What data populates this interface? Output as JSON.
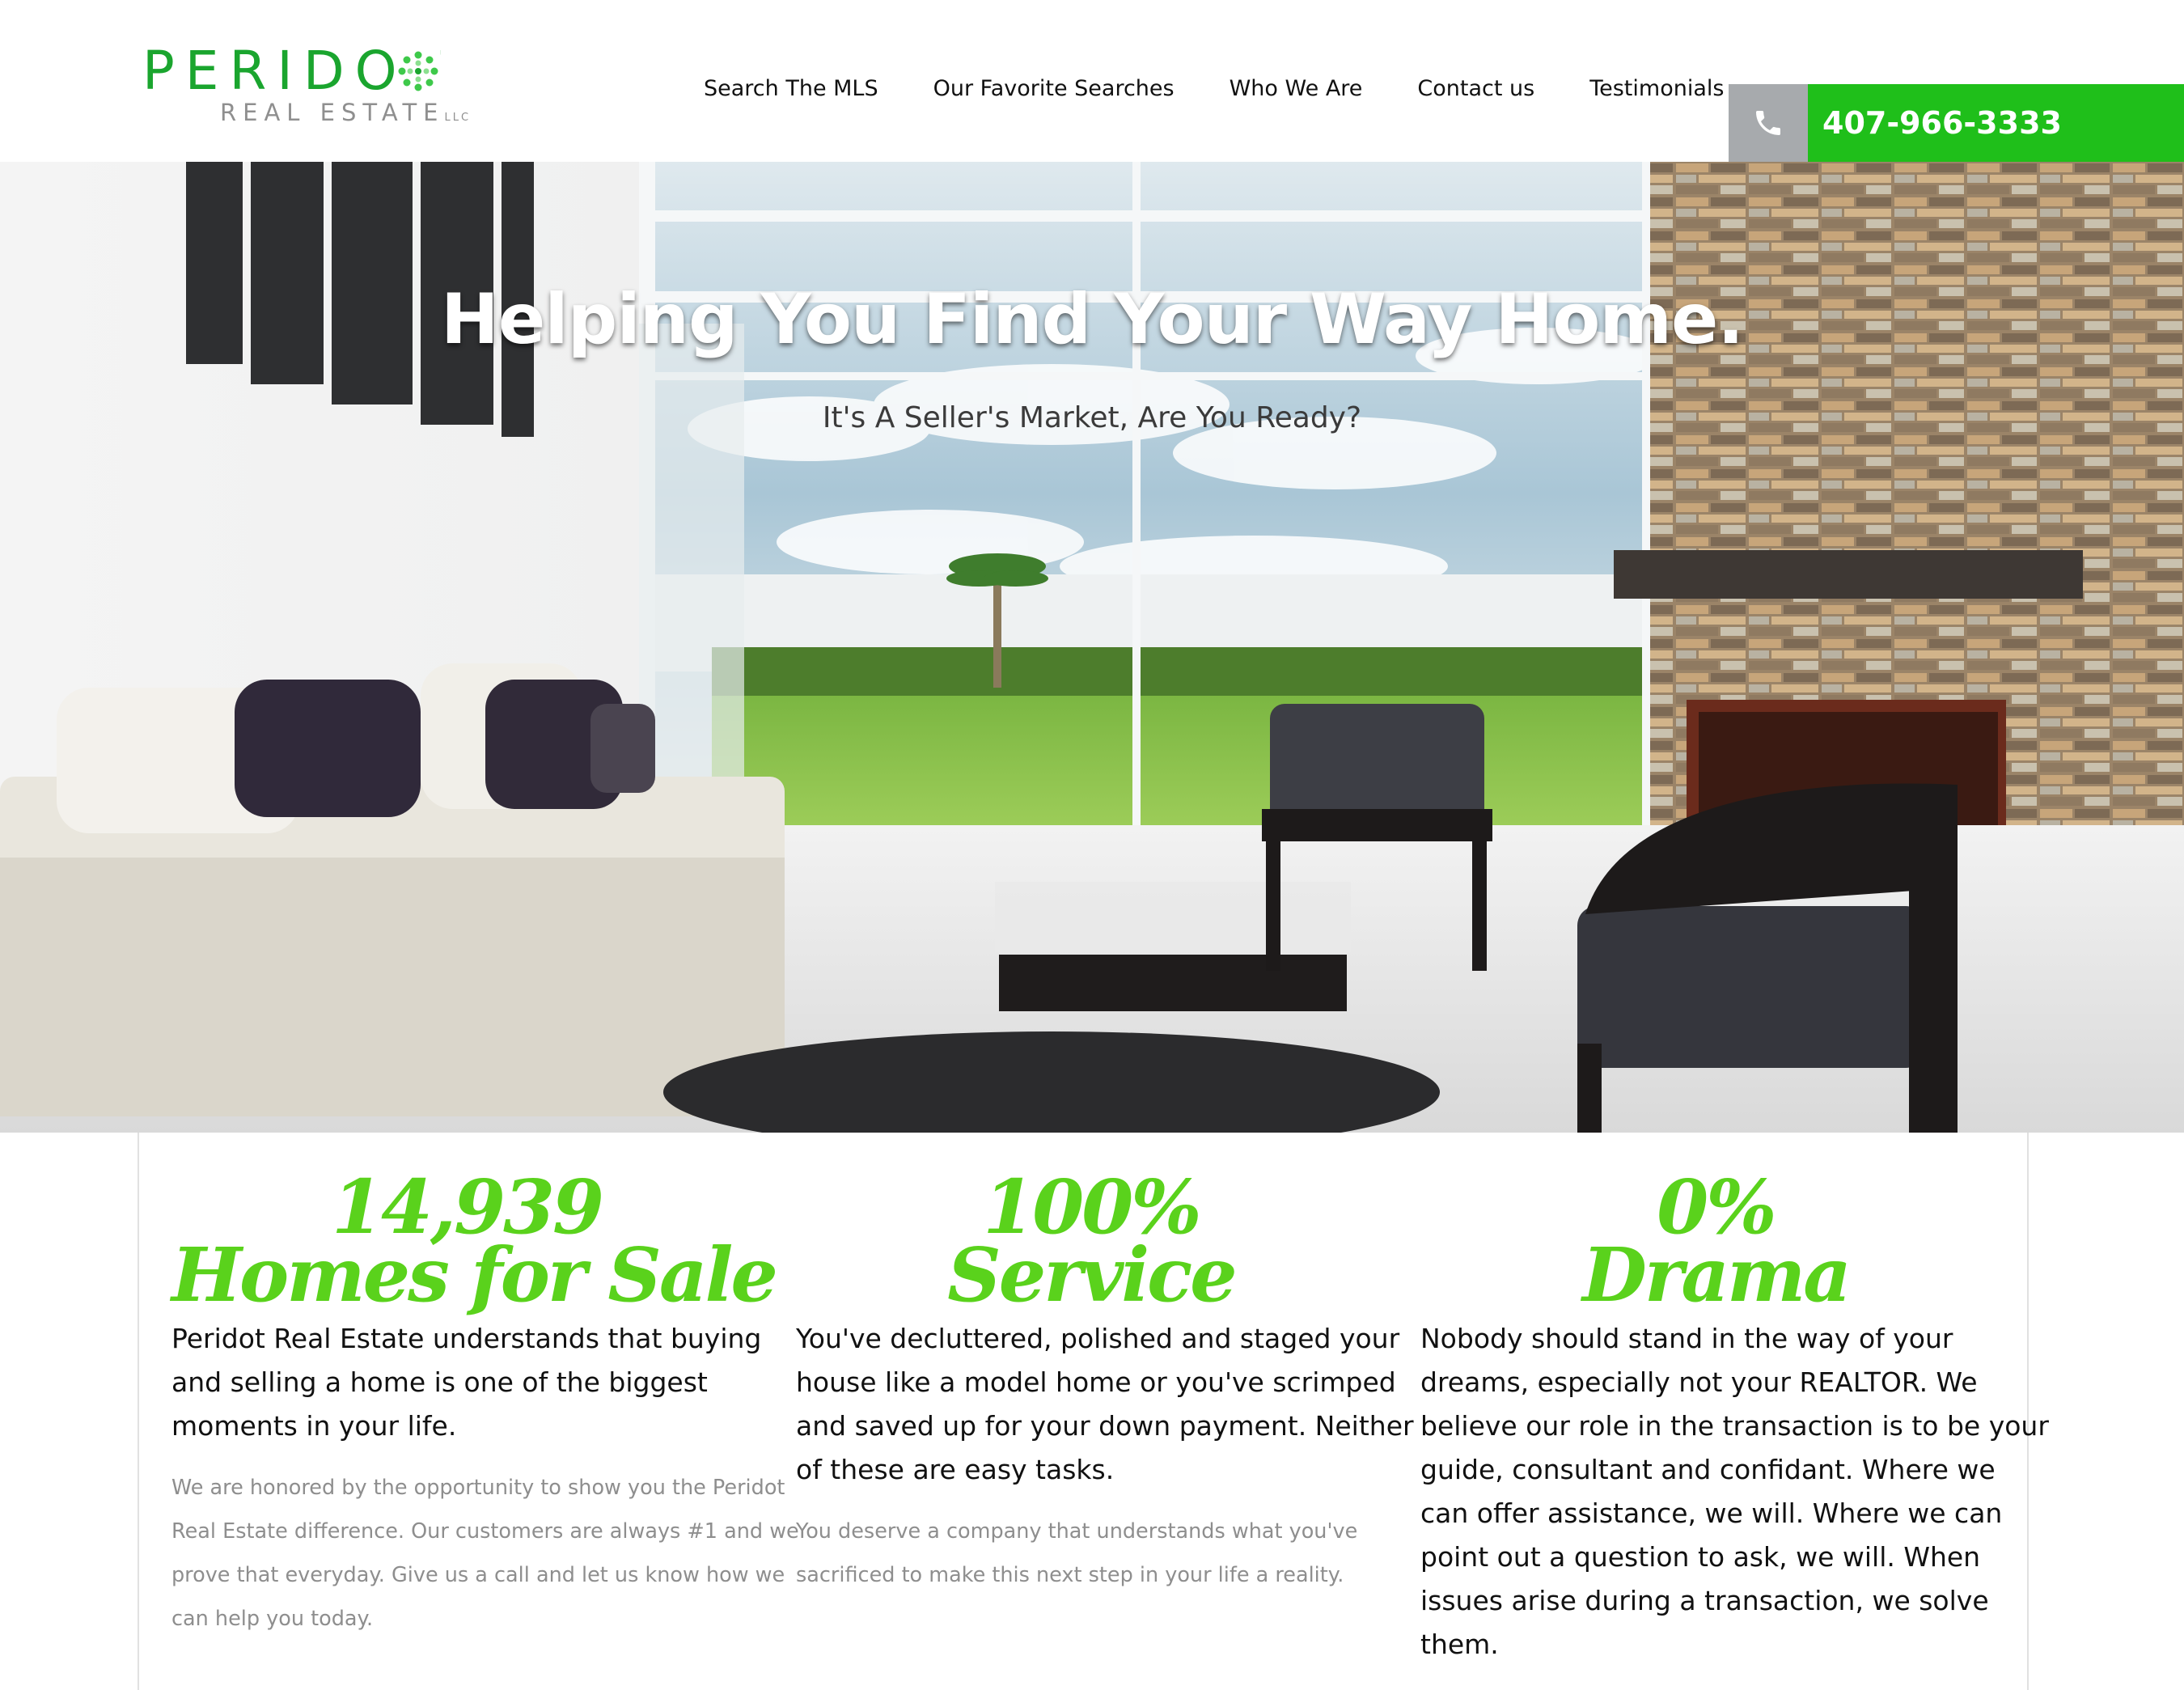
{
  "brand": {
    "name": "PERIDOT",
    "sub": "REAL ESTATE",
    "suffix": "LLC"
  },
  "nav": {
    "items": [
      {
        "label": "Search The MLS"
      },
      {
        "label": "Our Favorite Searches"
      },
      {
        "label": "Who We Are"
      },
      {
        "label": "Contact us"
      },
      {
        "label": "Testimonials"
      }
    ],
    "phone": "407-966-3333"
  },
  "hero": {
    "title": "Helping You Find Your Way Home.",
    "subtitle": "It's A Seller's Market, Are You Ready?"
  },
  "features": [
    {
      "stat": "14,939",
      "caption": "Homes for Sale",
      "lead": [
        "Peridot Real Estate understands that buying",
        "and selling a home is one of the biggest",
        "moments in your life."
      ],
      "minor": [
        "We are honored by the opportunity to show you the Peridot",
        "Real Estate difference. Our customers are always #1 and we",
        "prove that everyday. Give us a call and let us know how we",
        "can help you today."
      ]
    },
    {
      "stat": "100%",
      "caption": "Service",
      "lead": [
        "You've decluttered, polished and staged your",
        "house like a model home or you've scrimped",
        "and saved up for your down payment. Neither",
        "of these are easy tasks."
      ],
      "minor": [
        "You deserve a company that understands what you've",
        "sacrificed to make this next step in your life a reality."
      ]
    },
    {
      "stat": "0%",
      "caption": "Drama",
      "lead": [
        "Nobody should stand in the way of your",
        "dreams, especially not your REALTOR. We",
        "believe our role in the transaction is to be your",
        "guide, consultant and confidant. Where we",
        "can offer assistance, we will. Where we can",
        "point out a question to ask, we will. When",
        "issues arise during a transaction, we solve",
        "them."
      ],
      "minor": []
    }
  ],
  "colors": {
    "brand_green": "#1aa52e",
    "accent_green": "#5ad21c",
    "phone_green": "#1fbf1a",
    "phone_gray": "#a7aaad"
  },
  "icons": {
    "phone": "phone-icon",
    "logo": "gem-icon"
  }
}
